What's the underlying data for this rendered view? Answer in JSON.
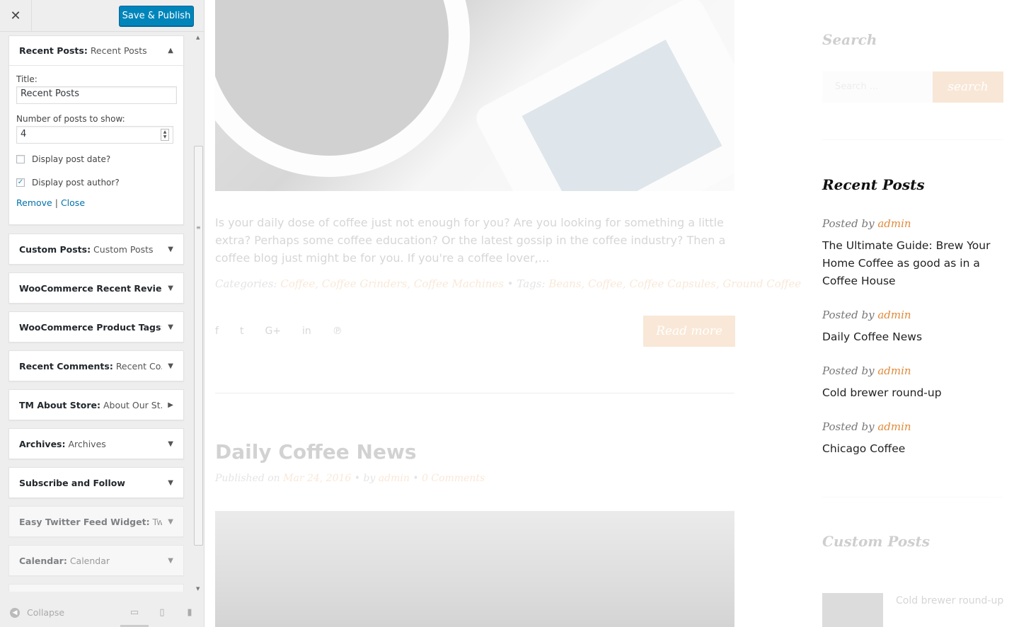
{
  "customizer": {
    "close_label": "✕",
    "publish_label": "Save & Publish",
    "open_widget": {
      "name": "Recent Posts",
      "subtitle": "Recent Posts",
      "title_label": "Title:",
      "title_value": "Recent Posts",
      "count_label": "Number of posts to show:",
      "count_value": "4",
      "show_date_label": "Display post date?",
      "show_date_checked": false,
      "show_author_label": "Display post author?",
      "show_author_checked": true,
      "remove_label": "Remove",
      "separator": "|",
      "close_label": "Close"
    },
    "widgets": [
      {
        "name": "Custom Posts",
        "subtitle": "Custom Posts"
      },
      {
        "name": "WooCommerce Recent Revie...",
        "subtitle": ""
      },
      {
        "name": "WooCommerce Product Tags:...",
        "subtitle": ""
      },
      {
        "name": "Recent Comments",
        "subtitle": "Recent Co..."
      },
      {
        "name": "TM About Store",
        "subtitle": "About Our St..."
      },
      {
        "name": "Archives",
        "subtitle": "Archives"
      },
      {
        "name": "Subscribe and Follow",
        "subtitle": ""
      },
      {
        "name": "Easy Twitter Feed Widget",
        "subtitle": "Twi..."
      },
      {
        "name": "Calendar",
        "subtitle": "Calendar"
      }
    ],
    "collapse_label": "Collapse"
  },
  "preview": {
    "excerpt": "Is your daily dose of coffee just not enough for you? Are you looking for something a little extra? Perhaps some coffee education? Or the latest gossip in the coffee industry? Then a coffee blog just might be for you. If you're a coffee lover,…",
    "categories_label": "Categories:",
    "categories": "Coffee, Coffee Grinders, Coffee Machines",
    "tags_label": "Tags:",
    "tags": "Beans, Coffee, Coffee Capsules, Ground Coffee",
    "read_more": "Read more",
    "post_title": "Daily Coffee News",
    "published_label": "Published on",
    "published_date": "Mar 24, 2016",
    "by_label": "by",
    "author": "admin",
    "comments": "0 Comments"
  },
  "sidebar": {
    "search_title": "Search",
    "search_placeholder": "Search ...",
    "search_button": "search",
    "recent_title": "Recent Posts",
    "posted_by": "Posted by",
    "recent_posts": [
      {
        "author": "admin",
        "title": "The Ultimate Guide: Brew Your Home Coffee as good as in a Coffee House"
      },
      {
        "author": "admin",
        "title": "Daily Coffee News"
      },
      {
        "author": "admin",
        "title": "Cold brewer round-up"
      },
      {
        "author": "admin",
        "title": "Chicago Coffee"
      }
    ],
    "custom_title": "Custom Posts",
    "custom_item_title": "Cold brewer round-up"
  },
  "colors": {
    "accent": "#e08a3a",
    "primary_button": "#0085ba",
    "link": "#0073aa"
  }
}
